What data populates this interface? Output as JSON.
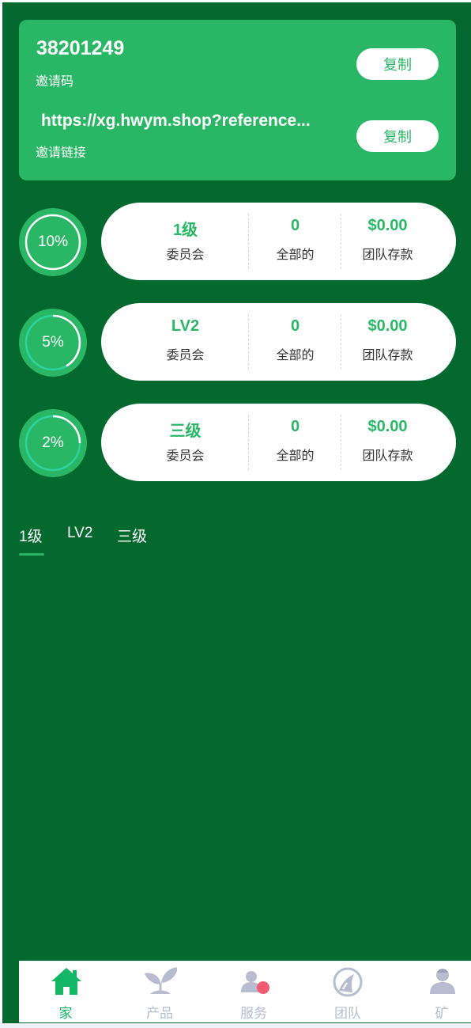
{
  "invite": {
    "code": "38201249",
    "code_label": "邀请码",
    "link": "https://xg.hwym.shop?reference...",
    "link_label": "邀请链接",
    "copy_label": "复制"
  },
  "levels": [
    {
      "percent": 10,
      "percent_text": "10%",
      "level": "1级",
      "level_label": "委员会",
      "count": "0",
      "count_label": "全部的",
      "amount": "$0.00",
      "amount_label": "团队存款"
    },
    {
      "percent": 5,
      "percent_text": "5%",
      "level": "LV2",
      "level_label": "委员会",
      "count": "0",
      "count_label": "全部的",
      "amount": "$0.00",
      "amount_label": "团队存款"
    },
    {
      "percent": 2,
      "percent_text": "2%",
      "level": "三级",
      "level_label": "委员会",
      "count": "0",
      "count_label": "全部的",
      "amount": "$0.00",
      "amount_label": "团队存款"
    }
  ],
  "tabs": [
    "1级",
    "LV2",
    "三级"
  ],
  "active_tab": "1级",
  "nav": [
    {
      "label": "家",
      "icon": "home-icon",
      "active": true
    },
    {
      "label": "产品",
      "icon": "sprout-icon",
      "active": false
    },
    {
      "label": "服务",
      "icon": "service-icon",
      "active": false
    },
    {
      "label": "团队",
      "icon": "team-icon",
      "active": false
    },
    {
      "label": "矿",
      "icon": "user-icon",
      "active": false
    }
  ],
  "colors": {
    "background": "#04692f",
    "accent": "#29b765",
    "nav_active": "#13b664",
    "nav_inactive": "#b7bcd0",
    "ring_progress": "#2ed4a0",
    "badge": "#f05b6f"
  }
}
